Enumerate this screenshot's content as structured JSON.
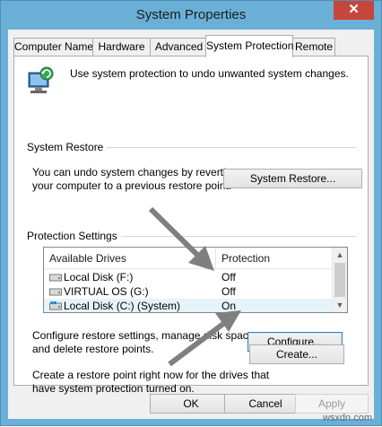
{
  "window": {
    "title": "System Properties",
    "close_glyph": "✕"
  },
  "tabs": [
    {
      "label": "Computer Name"
    },
    {
      "label": "Hardware"
    },
    {
      "label": "Advanced"
    },
    {
      "label": "System Protection"
    },
    {
      "label": "Remote"
    }
  ],
  "panel": {
    "intro": "Use system protection to undo unwanted system changes.",
    "system_restore": {
      "heading": "System Restore",
      "desc_line1": "You can undo system changes by reverting",
      "desc_line2": "your computer to a previous restore point.",
      "button": "System Restore..."
    },
    "protection": {
      "heading": "Protection Settings",
      "columns": [
        "Available Drives",
        "Protection"
      ],
      "rows": [
        {
          "drive": "Local Disk (F:)",
          "protection": "Off"
        },
        {
          "drive": "VIRTUAL OS (G:)",
          "protection": "Off"
        },
        {
          "drive": "Local Disk (C:) (System)",
          "protection": "On"
        }
      ],
      "configure_desc_line1": "Configure restore settings, manage disk space,",
      "configure_desc_line2": "and delete restore points.",
      "configure_button": "Configure...",
      "create_desc_line1": "Create a restore point right now for the drives that",
      "create_desc_line2": "have system protection turned on.",
      "create_button": "Create..."
    }
  },
  "footer": {
    "ok": "OK",
    "cancel": "Cancel",
    "apply": "Apply"
  },
  "watermark": "wsxdn.com",
  "colors": {
    "title_bar": "#6ab0d6",
    "close_button": "#c7463b",
    "annotation_arrow": "#7f7f7f"
  }
}
